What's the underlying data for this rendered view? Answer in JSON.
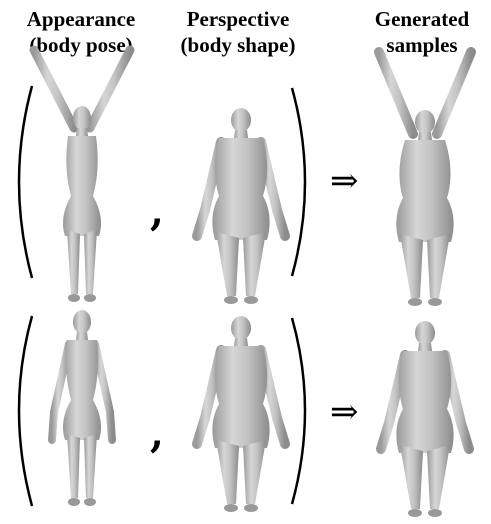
{
  "headers": {
    "appearance": {
      "line1": "Appearance",
      "line2": "(body pose)"
    },
    "perspective": {
      "line1": "Perspective",
      "line2": "(body shape)"
    },
    "generated": {
      "line1": "Generated",
      "line2": "samples"
    }
  },
  "symbols": {
    "comma": ",",
    "arrow": "⇒"
  },
  "rows": [
    {
      "appearance_pose": "arms-raised",
      "appearance_build": "slim",
      "perspective_pose": "arms-down",
      "perspective_build": "heavy",
      "result_pose": "arms-raised",
      "result_build": "heavy"
    },
    {
      "appearance_pose": "arms-down",
      "appearance_build": "slim",
      "perspective_pose": "arms-down",
      "perspective_build": "heavy",
      "result_pose": "arms-down",
      "result_build": "heavy"
    }
  ],
  "colors": {
    "figure_fill": "#bdbdbd",
    "figure_shadow": "#8f8f8f",
    "bracket": "#000000"
  }
}
